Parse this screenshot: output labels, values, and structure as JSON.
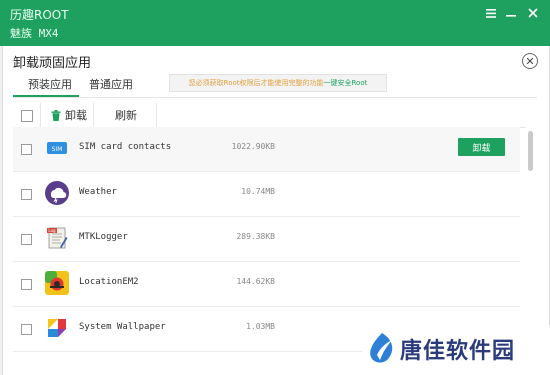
{
  "window": {
    "app_name": "历趣ROOT",
    "device_name": "魅族 MX4"
  },
  "panel": {
    "title": "卸载顽固应用",
    "tabs": [
      {
        "label": "预装应用",
        "active": true
      },
      {
        "label": "普通应用",
        "active": false
      }
    ],
    "notice_text": "您必须获取Root权限后才能使用完整的功能",
    "notice_link": "一键安全Root"
  },
  "toolbar": {
    "uninstall_label": "卸载",
    "refresh_label": "刷新"
  },
  "apps": [
    {
      "name": "SIM card contacts",
      "size": "1022.90KB",
      "icon": "sim-icon",
      "action": "卸载",
      "selected": true
    },
    {
      "name": "Weather",
      "size": "10.74MB",
      "icon": "weather-icon"
    },
    {
      "name": "MTKLogger",
      "size": "289.38KB",
      "icon": "log-icon"
    },
    {
      "name": "LocationEM2",
      "size": "144.62KB",
      "icon": "location-icon"
    },
    {
      "name": "System Wallpaper",
      "size": "1.03MB",
      "icon": "wallpaper-icon"
    }
  ],
  "watermark": {
    "text": "唐佳软件园",
    "icon": "watermark-logo-icon"
  },
  "colors": {
    "brand_green": "#1ea15f",
    "notice_orange": "#e2a03d",
    "watermark_navy": "#2a3b7c"
  }
}
